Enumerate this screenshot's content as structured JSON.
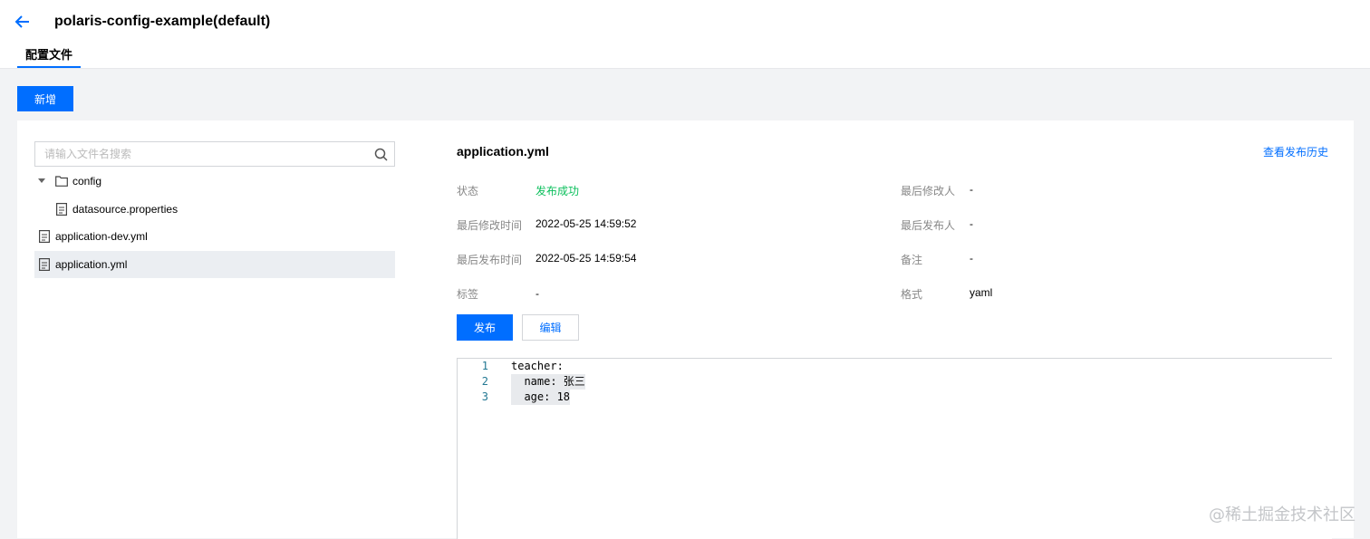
{
  "header": {
    "title": "polaris-config-example(default)",
    "tab_label": "配置文件"
  },
  "toolbar": {
    "add_label": "新增"
  },
  "search": {
    "placeholder": "请输入文件名搜索"
  },
  "tree": {
    "folder": "config",
    "items": [
      {
        "label": "datasource.properties"
      },
      {
        "label": "application-dev.yml"
      },
      {
        "label": "application.yml",
        "selected": true
      }
    ]
  },
  "detail": {
    "file_name": "application.yml",
    "history_link": "查看发布历史",
    "fields": {
      "status_label": "状态",
      "status_value": "发布成功",
      "last_modifier_label": "最后修改人",
      "last_modifier_value": "-",
      "last_modified_time_label": "最后修改时间",
      "last_modified_time_value": "2022-05-25 14:59:52",
      "last_publisher_label": "最后发布人",
      "last_publisher_value": "-",
      "last_published_time_label": "最后发布时间",
      "last_published_time_value": "2022-05-25 14:59:54",
      "remark_label": "备注",
      "remark_value": "-",
      "tags_label": "标签",
      "tags_value": "-",
      "format_label": "格式",
      "format_value": "yaml"
    },
    "publish_label": "发布",
    "edit_label": "编辑",
    "code_lines": [
      {
        "num": "1",
        "text": "teacher:"
      },
      {
        "num": "2",
        "text": "  name: 张三"
      },
      {
        "num": "3",
        "text": "  age: 18"
      }
    ]
  },
  "watermark": "@稀土掘金技术社区",
  "colors": {
    "primary": "#006eff",
    "success": "#0abf5b",
    "background": "#f2f3f5"
  }
}
